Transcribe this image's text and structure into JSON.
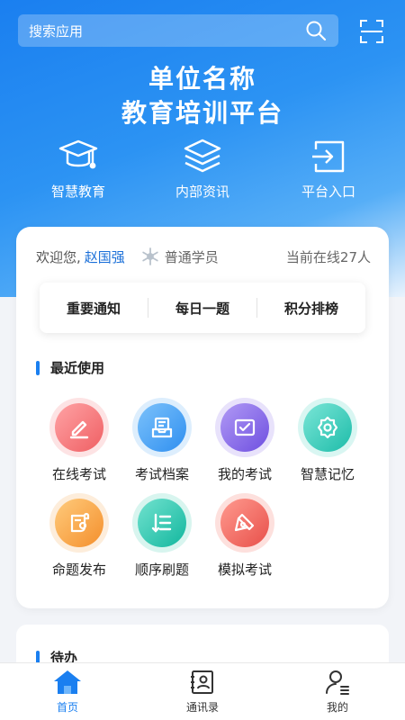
{
  "search": {
    "placeholder": "搜索应用"
  },
  "hero": {
    "title_line1": "单位名称",
    "title_line2": "教育培训平台"
  },
  "quick_nav": [
    {
      "label": "智慧教育",
      "icon": "graduation-cap-icon"
    },
    {
      "label": "内部资讯",
      "icon": "layers-icon"
    },
    {
      "label": "平台入口",
      "icon": "login-icon"
    }
  ],
  "welcome": {
    "greeting": "欢迎您,",
    "user": "赵国强",
    "role": "普通学员",
    "online": "当前在线27人"
  },
  "tabs": [
    "重要通知",
    "每日一题",
    "积分排榜"
  ],
  "recent": {
    "title": "最近使用",
    "apps": [
      {
        "label": "在线考试",
        "icon": "pen-icon",
        "color": "#f46f73"
      },
      {
        "label": "考试档案",
        "icon": "archive-icon",
        "color": "#3b9cf1"
      },
      {
        "label": "我的考试",
        "icon": "exam-icon",
        "color": "#7d5de6"
      },
      {
        "label": "智慧记忆",
        "icon": "gear-icon",
        "color": "#2fc8b6"
      },
      {
        "label": "命题发布",
        "icon": "scroll-icon",
        "color": "#f7a23b"
      },
      {
        "label": "顺序刷题",
        "icon": "list-icon",
        "color": "#24c3aa"
      },
      {
        "label": "模拟考试",
        "icon": "sign-icon",
        "color": "#f0625c"
      }
    ]
  },
  "todo": {
    "title": "待办"
  },
  "tabbar": [
    {
      "label": "首页",
      "icon": "home-icon",
      "active": true
    },
    {
      "label": "通讯录",
      "icon": "contacts-icon",
      "active": false
    },
    {
      "label": "我的",
      "icon": "profile-icon",
      "active": false
    }
  ],
  "colors": {
    "primary": "#1a7ff0"
  }
}
